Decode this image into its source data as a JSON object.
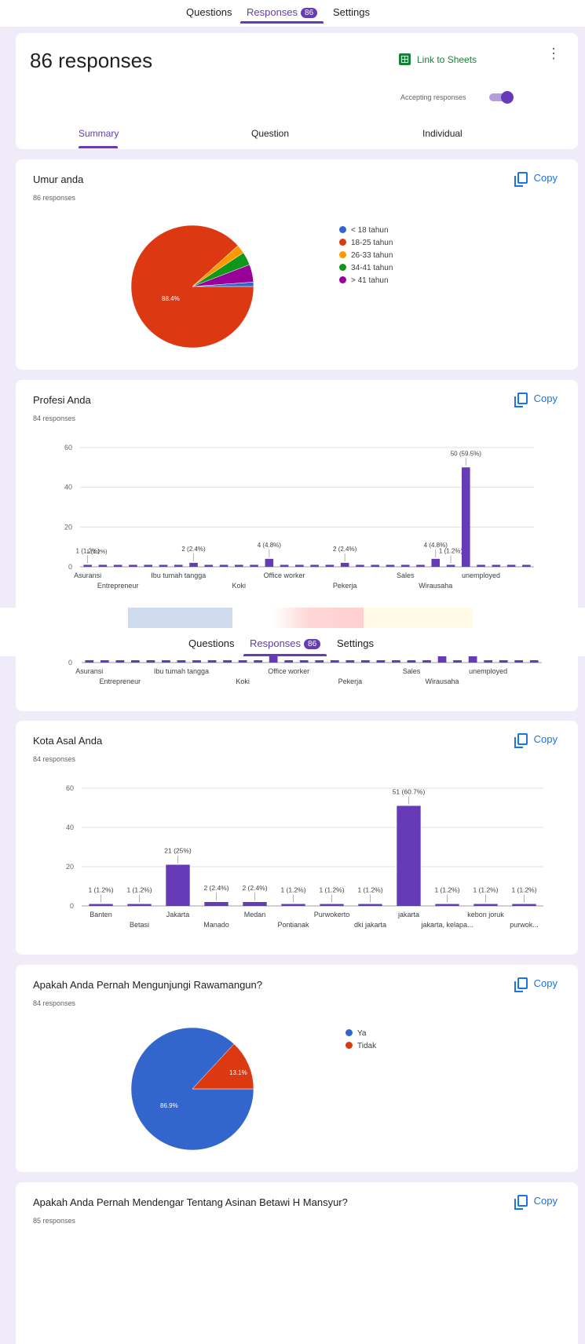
{
  "nav": {
    "tabs": [
      {
        "label": "Questions"
      },
      {
        "label": "Responses",
        "badge": "86"
      },
      {
        "label": "Settings"
      }
    ]
  },
  "header": {
    "title": "86 responses",
    "link_to_sheets": "Link to Sheets",
    "accepting_label": "Accepting responses",
    "accepting_on": true,
    "view_tabs": [
      "Summary",
      "Question",
      "Individual"
    ]
  },
  "copy_label": "Copy",
  "colors": {
    "accent": "#673ab7",
    "blue": "#3366cc",
    "red": "#dc3912",
    "orange": "#ff9900",
    "green": "#109618",
    "purple": "#990099",
    "bar": "#673ab7"
  },
  "q_umur": {
    "title": "Umur anda",
    "count": "86 responses",
    "legend": [
      "< 18 tahun",
      "18-25 tahun",
      "26-33 tahun",
      "34-41 tahun",
      "> 41 tahun"
    ],
    "slice_label": "88.4%"
  },
  "q_profesi": {
    "title": "Profesi Anda",
    "count": "84 responses",
    "x_labels_row1": [
      "Asuransi",
      "Ibu tumah tangga",
      "Koki",
      "Office worker",
      "Sales",
      "unemployed"
    ],
    "x_labels_row2": [
      "Entrepreneur",
      "Pekerja",
      "Wirausaha"
    ],
    "x_labels_row2_second": [
      "Entrepreneur",
      "Koki",
      "Pekerja",
      "Wirausaha"
    ]
  },
  "q_kota": {
    "title": "Kota Asal Anda",
    "count": "84 responses"
  },
  "q_rawamangun": {
    "title": "Apakah Anda Pernah Mengunjungi Rawamangun?",
    "count": "84 responses",
    "legend": [
      "Ya",
      "Tidak"
    ],
    "labels": [
      "86.9%",
      "13.1%"
    ]
  },
  "q_asinan": {
    "title": "Apakah Anda Pernah Mendengar Tentang Asinan Betawi H Mansyur?",
    "count": "85 responses"
  },
  "chart_data": [
    {
      "type": "pie",
      "title": "Umur anda",
      "categories": [
        "< 18 tahun",
        "18-25 tahun",
        "26-33 tahun",
        "34-41 tahun",
        "> 41 tahun"
      ],
      "values": [
        1,
        76,
        2,
        3,
        4
      ]
    },
    {
      "type": "bar",
      "title": "Profesi Anda",
      "categories": [
        "Asuransi",
        "",
        "Entrepreneur",
        "",
        "",
        "",
        "Ibu tumah tangga",
        "",
        "",
        "",
        "Koki",
        "",
        "",
        "Office worker",
        "",
        "",
        "",
        "Pekerja",
        "",
        "",
        "",
        "Sales",
        "",
        "Wirausaha",
        "",
        "",
        "unemployed",
        "",
        "",
        ""
      ],
      "values": [
        1,
        1,
        1,
        1,
        1,
        1,
        1,
        2,
        1,
        1,
        1,
        1,
        4,
        1,
        1,
        1,
        1,
        2,
        1,
        1,
        1,
        1,
        1,
        4,
        1,
        50,
        1,
        1,
        1,
        1
      ],
      "data_labels": [
        "1 (1.2%)",
        "",
        "",
        "",
        "",
        "",
        "",
        "2 (2.4%)",
        "",
        "",
        "",
        "",
        "4 (4.8%)",
        "",
        "",
        "",
        "",
        "2 (2.4%)",
        "",
        "",
        "",
        "",
        "",
        "4 (4.8%)",
        "1 (1.2%)",
        "50 (59.5%)",
        "",
        "",
        "",
        ""
      ],
      "ylim": [
        0,
        60
      ],
      "yticks": [
        0,
        20,
        40,
        60
      ],
      "grid": true
    },
    {
      "type": "bar",
      "title": "Kota Asal Anda",
      "categories": [
        "Banten",
        "Betasi",
        "Jakarta",
        "Manado",
        "Medan",
        "Pontianak",
        "Purwokerto",
        "dki jakarta",
        "jakarta",
        "jakarta, kelapa...",
        "kebon joruk",
        "purwok..."
      ],
      "values": [
        1,
        1,
        21,
        2,
        2,
        1,
        1,
        1,
        51,
        1,
        1,
        1
      ],
      "data_labels": [
        "1 (1.2%)",
        "1 (1.2%)",
        "21 (25%)",
        "2 (2.4%)",
        "2 (2.4%)",
        "1 (1.2%)",
        "1 (1.2%)",
        "1 (1.2%)",
        "51 (60.7%)",
        "1 (1.2%)",
        "1 (1.2%)",
        "1 (1.2%)"
      ],
      "ylim": [
        0,
        60
      ],
      "yticks": [
        0,
        20,
        40,
        60
      ],
      "grid": true
    },
    {
      "type": "pie",
      "title": "Apakah Anda Pernah Mengunjungi Rawamangun?",
      "categories": [
        "Ya",
        "Tidak"
      ],
      "values": [
        86.9,
        13.1
      ]
    }
  ]
}
